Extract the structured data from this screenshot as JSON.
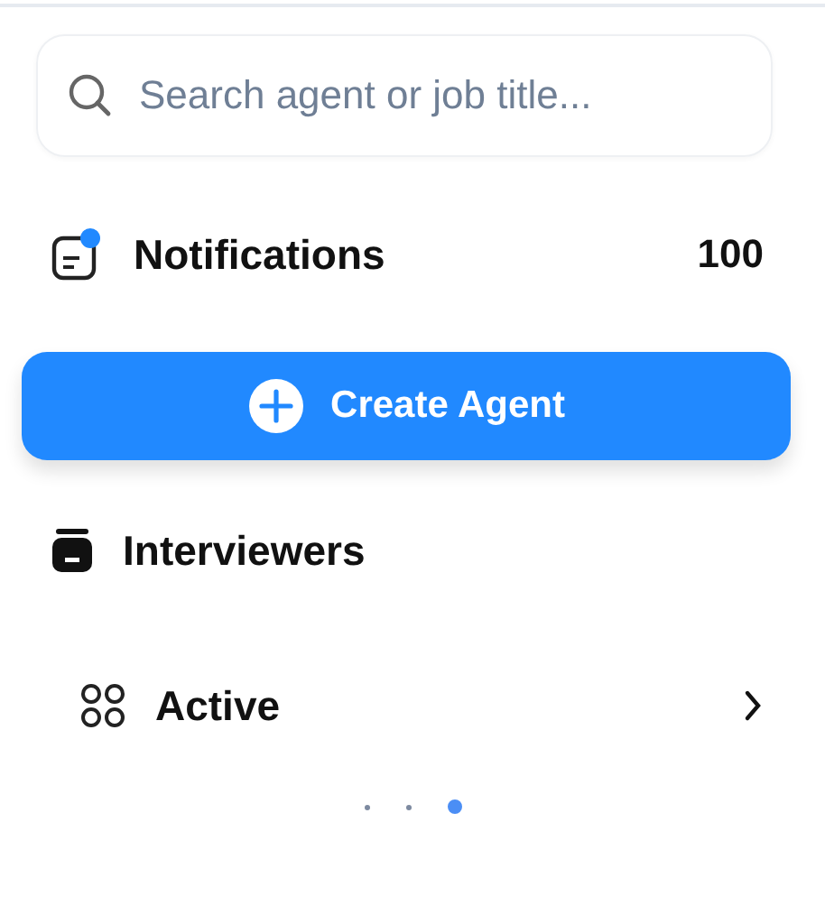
{
  "search": {
    "placeholder": "Search agent or job title..."
  },
  "notifications": {
    "label": "Notifications",
    "count": "100",
    "unread": true
  },
  "create_button": {
    "label": "Create Agent"
  },
  "section": {
    "title": "Interviewers"
  },
  "nav_items": [
    {
      "label": "Active",
      "expanded": false
    }
  ],
  "pager": [
    {
      "selected": false
    },
    {
      "selected": false
    },
    {
      "selected": true
    }
  ]
}
